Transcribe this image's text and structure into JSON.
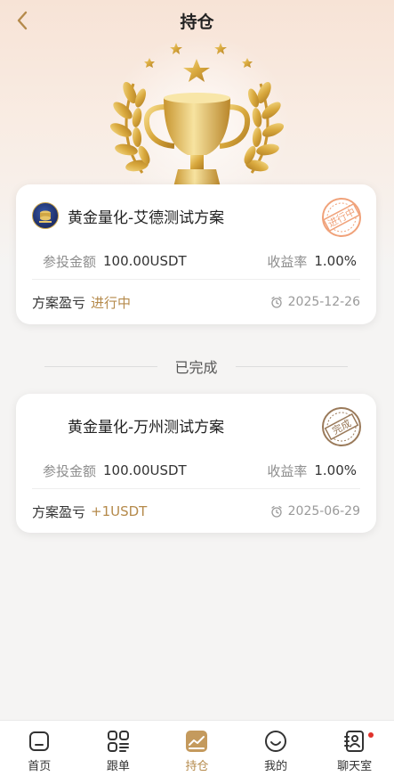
{
  "header": {
    "title": "持仓"
  },
  "active_plans": [
    {
      "name": "黄金量化-艾德测试方案",
      "stamp": "进行中",
      "invest_label": "参投金额",
      "invest_value": "100.00USDT",
      "rate_label": "收益率",
      "rate_value": "1.00%",
      "pnl_label": "方案盈亏",
      "pnl_value": "进行中",
      "date": "2025-12-26"
    }
  ],
  "completed_section": {
    "label": "已完成"
  },
  "completed_plans": [
    {
      "name": "黄金量化-万州测试方案",
      "stamp": "完成",
      "invest_label": "参投金额",
      "invest_value": "100.00USDT",
      "rate_label": "收益率",
      "rate_value": "1.00%",
      "pnl_label": "方案盈亏",
      "pnl_value": "+1USDT",
      "date": "2025-06-29"
    }
  ],
  "tabbar": {
    "items": [
      {
        "label": "首页",
        "icon": "home-icon"
      },
      {
        "label": "跟单",
        "icon": "grid-icon"
      },
      {
        "label": "持仓",
        "icon": "chart-icon",
        "active": true
      },
      {
        "label": "我的",
        "icon": "smile-icon"
      },
      {
        "label": "聊天室",
        "icon": "contact-icon",
        "badge": true
      }
    ]
  },
  "colors": {
    "accent_gold": "#b58a4b",
    "stamp_orange": "#f0a27a",
    "stamp_brown": "#9a7a5a",
    "badge_red": "#e0322b"
  }
}
